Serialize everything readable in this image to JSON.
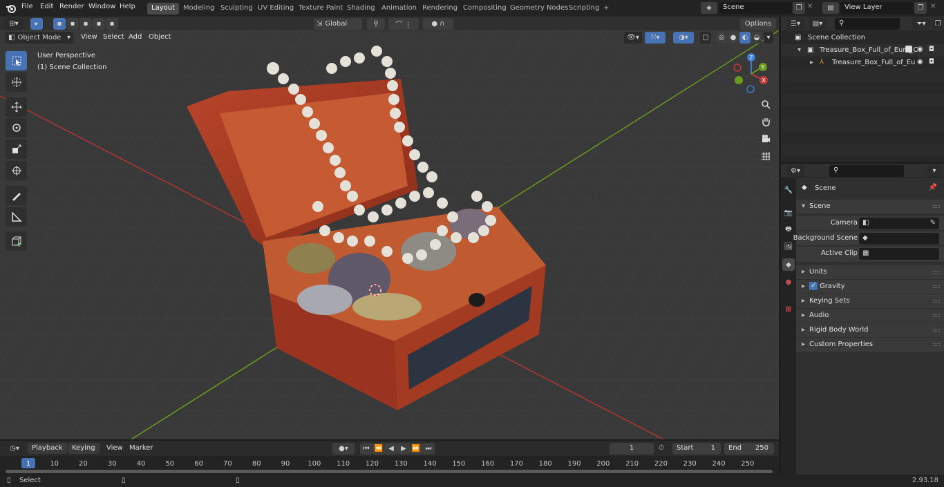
{
  "app": {
    "menus": [
      "File",
      "Edit",
      "Render",
      "Window",
      "Help"
    ],
    "workspaces": [
      "Layout",
      "Modeling",
      "Sculpting",
      "UV Editing",
      "Texture Paint",
      "Shading",
      "Animation",
      "Rendering",
      "Compositing",
      "Geometry Nodes",
      "Scripting"
    ],
    "active_workspace": "Layout",
    "scene": "Scene",
    "view_layer": "View Layer"
  },
  "viewport": {
    "mode": "Object Mode",
    "menus": [
      "View",
      "Select",
      "Add",
      "Object"
    ],
    "transform": "Global",
    "options": "Options",
    "overlay_title": "User Perspective",
    "overlay_sub": "(1) Scene Collection",
    "gizmo": {
      "x": "X",
      "y": "Y",
      "z": "Z"
    }
  },
  "outliner": {
    "root": "Scene Collection",
    "items": [
      {
        "label": "Treasure_Box_Full_of_Euro_C",
        "level": 1
      },
      {
        "label": "Treasure_Box_Full_of_Eu",
        "level": 2
      }
    ]
  },
  "properties": {
    "context": "Scene",
    "panel_title": "Scene",
    "fields": [
      {
        "label": "Camera",
        "value": ""
      },
      {
        "label": "Background Scene",
        "value": ""
      },
      {
        "label": "Active Clip",
        "value": ""
      }
    ],
    "sections": [
      {
        "label": "Units"
      },
      {
        "label": "Gravity",
        "checked": true
      },
      {
        "label": "Keying Sets"
      },
      {
        "label": "Audio"
      },
      {
        "label": "Rigid Body World"
      },
      {
        "label": "Custom Properties"
      }
    ]
  },
  "timeline": {
    "menus": [
      "Playback",
      "Keying",
      "View",
      "Marker"
    ],
    "current_frame": "1",
    "start_label": "Start",
    "start": "1",
    "end_label": "End",
    "end": "250",
    "ticks": [
      "1",
      "10",
      "20",
      "30",
      "40",
      "50",
      "60",
      "70",
      "80",
      "90",
      "100",
      "110",
      "120",
      "130",
      "140",
      "150",
      "160",
      "170",
      "180",
      "190",
      "200",
      "210",
      "220",
      "230",
      "240",
      "250"
    ]
  },
  "status": {
    "left": "Select",
    "version": "2.93.18"
  },
  "colors": {
    "accent": "#4772b3",
    "x_axis": "#c03a3a",
    "y_axis": "#6a9a1f",
    "z_axis": "#3a7ad0"
  }
}
